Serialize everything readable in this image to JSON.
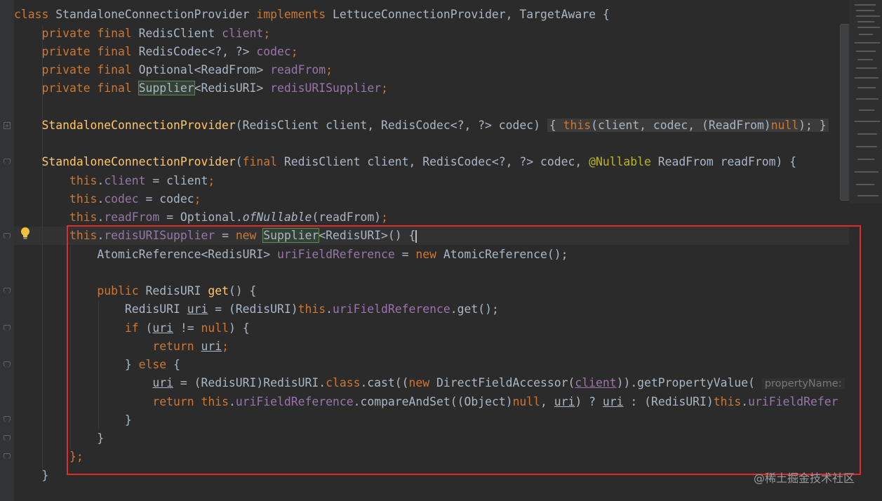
{
  "code": {
    "kw_class": "class",
    "class_name": "StandaloneConnectionProvider",
    "kw_implements": "implements",
    "interfaces": "LettuceConnectionProvider, TargetAware {",
    "kw_private_final": "private final",
    "type_redis_client": "RedisClient",
    "field_client": "client",
    "semi": ";",
    "type_redis_codec": "RedisCodec<?, ?>",
    "field_codec": "codec",
    "type_optional_readfrom": "Optional<ReadFrom>",
    "field_read_from": "readFrom",
    "type_supplier": "Supplier",
    "type_redisuri_generic": "<RedisURI>",
    "field_redis_uri_supplier": "redisURISupplier",
    "ctor1_name": "StandaloneConnectionProvider",
    "ctor1_params": "(RedisClient client, RedisCodec<?, ?> codec)",
    "ctor1_body_open": "{",
    "kw_this": "this",
    "ctor1_args_a": "(client, codec, (ReadFrom)",
    "kw_null": "null",
    "ctor1_args_b": ");",
    "ctor1_body_close": "}",
    "ctor2_name": "StandaloneConnectionProvider",
    "paren_open": "(",
    "kw_final": "final",
    "ctor2_params_a": " RedisClient client, RedisCodec<?, ?> codec, ",
    "annotation_nullable": "@Nullable",
    "ctor2_params_b": " ReadFrom readFrom) {",
    "dot": ".",
    "assign_client": " = client",
    "assign_codec": " = codec",
    "assign_optional": " = Optional.",
    "method_of_nullable": "ofNullable",
    "arg_read_from": "(readFrom)",
    "assign_eq": " = ",
    "kw_new": "new",
    "anon_tail": "<RedisURI>() {",
    "atomic_ref_type": "AtomicReference<RedisURI> ",
    "field_uri_field_reference": "uriFieldReference",
    "atomic_ref_new": "AtomicReference();",
    "kw_public": "public",
    "type_redisuri": " RedisURI ",
    "method_get": "get",
    "get_sig_tail": "() {",
    "local_type": "RedisURI ",
    "local_uri": "uri",
    "cast_redisuri": "(RedisURI)",
    "call_get": ".get();",
    "kw_if": "if",
    "if_open": " (",
    "not_eq": " != ",
    "if_close": ") {",
    "kw_return": "return",
    "close_brace": "}",
    "kw_else": "else",
    "else_open": " {",
    "cast_expr_a": "(RedisURI)RedisURI.",
    "cast_expr_b": ".cast((",
    "dfa": " DirectFieldAccessor(",
    "get_prop": ")).getPropertyValue(",
    "hint_property_name": "propertyName:",
    "compare_and_set": ".compareAndSet((Object)",
    "comma_sp": ", ",
    "ternary_q": ") ? ",
    "ternary_colon": " : ",
    "field_uri_field_refer_cut": "uriFieldRefer",
    "close_semicolon": "};",
    "final_close": "}"
  },
  "watermark": "@稀土掘金技术社区",
  "icons": {
    "intention": "lightbulb-icon"
  },
  "colors": {
    "background": "#2b2b2b",
    "keyword": "#cc7832",
    "field": "#9876aa",
    "method": "#ffc66d",
    "annotation": "#bbb529",
    "text": "#a9b7c6",
    "highlight_border": "#e02b2b"
  }
}
